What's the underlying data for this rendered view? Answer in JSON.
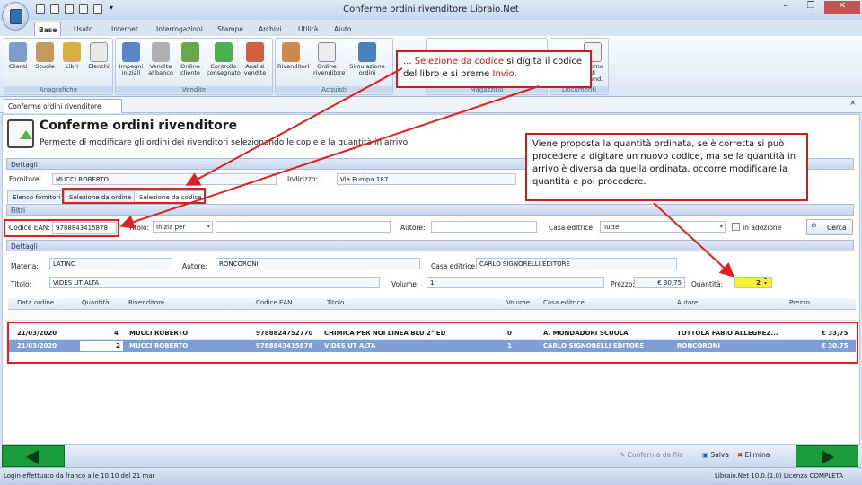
{
  "window": {
    "title": "Conferme ordini rivenditore   Libraio.Net",
    "min": "–",
    "restore": "❐",
    "close": "✕"
  },
  "ribbon_tabs": [
    "Base",
    "Usato",
    "Internet",
    "Interrogazioni",
    "Stampe",
    "Archivi",
    "Utilità",
    "Aiuto"
  ],
  "ribbon_groups": {
    "anagrafiche": {
      "label": "Anagrafiche",
      "buttons": [
        "Clienti",
        "Scuole",
        "Libri",
        "Elenchi"
      ]
    },
    "vendite": {
      "label": "Vendite",
      "buttons": [
        "Impegni iniziali",
        "Vendita al banco",
        "Ordine cliente",
        "Controllo consegnato",
        "Analisi vendite"
      ]
    },
    "acquisti": {
      "label": "Acquisti",
      "buttons": [
        "Rivenditori",
        "Ordine rivenditore",
        "Simulazione ordini"
      ]
    },
    "magazzino": {
      "label": "Magazzino"
    },
    "documenti": {
      "label": "Documenti",
      "buttons": [
        "Ritorno di rivend."
      ]
    }
  },
  "doc_tab": {
    "label": "Conferme ordini rivenditore",
    "close": "×"
  },
  "header": {
    "title": "Conferme ordini rivenditore",
    "subtitle": "Permette di modificare gli ordini dei rivenditori selezionando le copie e la quantità in arrivo"
  },
  "dettagli": {
    "section": "Dettagli",
    "fornitore_label": "Fornitore:",
    "fornitore_value": "MUCCI ROBERTO",
    "indirizzo_label": "Indirizzo:",
    "indirizzo_value": "Via Europa 187"
  },
  "subtabs": [
    "Elenco fornitori",
    "Selezione da ordine",
    "Selezione da codice"
  ],
  "filtri": {
    "section": "Filtri",
    "ean_label": "Codice EAN:",
    "ean_value": "9788843415878",
    "titolo_label": "Titolo:",
    "titolo_mode": "Inizia per",
    "autore_label": "Autore:",
    "casa_label": "Casa editrice:",
    "casa_value": "Tutte",
    "adozione_label": "In adozione",
    "cerca_label": "Cerca"
  },
  "dettagli2": {
    "section": "Dettagli",
    "materia_label": "Materia:",
    "materia_value": "LATINO",
    "autore_label": "Autore:",
    "autore_value": "RONCORONI",
    "casa_label": "Casa editrice:",
    "casa_value": "CARLO SIGNORELLI EDITORE",
    "titolo_label": "Titolo:",
    "titolo_value": "VIDES UT ALTA",
    "volume_label": "Volume:",
    "volume_value": "1",
    "prezzo_label": "Prezzo:",
    "prezzo_value": "€ 30,75",
    "quantita_label": "Quantità:",
    "quantita_value": "2"
  },
  "grid": {
    "columns": [
      "Data ordine",
      "Quantità",
      "Rivenditore",
      "Codice EAN",
      "Titolo",
      "Volume",
      "Casa editrice",
      "Autore",
      "Prezzo"
    ],
    "rows": [
      [
        "21/03/2020",
        "4",
        "MUCCI ROBERTO",
        "9788824752770",
        "CHIMICA PER NOI LINEA BLU 2° ED",
        "0",
        "A. MONDADORI SCUOLA",
        "TOTTOLA FABIO ALLEGREZ...",
        "€ 33,75"
      ],
      [
        "21/03/2020",
        "2",
        "MUCCI ROBERTO",
        "9788843415878",
        "VIDES UT ALTA",
        "1",
        "CARLO SIGNORELLI EDITORE",
        "RONCORONI",
        "€ 30,75"
      ]
    ]
  },
  "actions": {
    "conferma": "Conferma da file",
    "salva": "Salva",
    "elimina": "Elimina"
  },
  "status": {
    "left": "Login effettuato da franco alle 10:10 del 21 mar",
    "right": "Libraio.Net 10.0.(1.0) Licenza COMPLETA"
  },
  "callout1": {
    "pre": "... ",
    "hl1": "Selezione da codice",
    "mid": " si digita il codice del libro e si preme ",
    "hl2": "Invio",
    "post": "."
  },
  "callout2": {
    "text": "Viene proposta la quantità ordinata, se è corretta si può procedere a digitare un nuovo codice, ma se la quantità in arrivo è diversa da quella ordinata, occorre modificare la quantità e poi procedere."
  },
  "colors": {
    "accent_red": "#e02020",
    "nav_green": "#1a9e3c",
    "selected_row": "#7f9fd4"
  }
}
